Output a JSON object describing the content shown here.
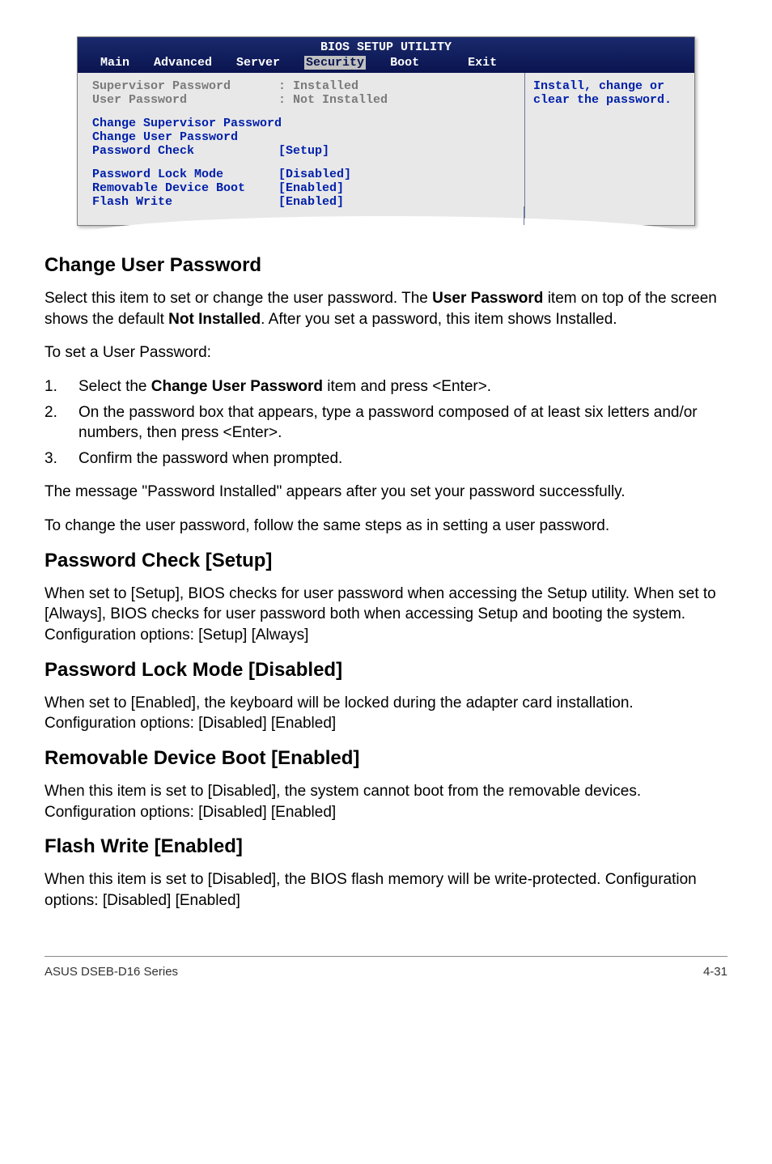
{
  "bios": {
    "title": "BIOS SETUP UTILITY",
    "tabs": {
      "main": "Main",
      "advanced": "Advanced",
      "server": "Server",
      "security": "Security",
      "boot": "Boot",
      "exit": "Exit"
    },
    "left": {
      "sup_pwd_label": "Supervisor Password",
      "sup_pwd_value": ": Installed",
      "user_pwd_label": "User Password",
      "user_pwd_value": ": Not Installed",
      "change_sup": "Change Supervisor Password",
      "change_user": "Change User Password",
      "pwd_check": "Password Check",
      "pwd_check_val": "[Setup]",
      "pwd_lock": "Password Lock Mode",
      "pwd_lock_val": "[Disabled]",
      "removable": "Removable Device Boot",
      "removable_val": "[Enabled]",
      "flash": "Flash Write",
      "flash_val": "[Enabled]"
    },
    "right": {
      "help1": "Install, change or",
      "help2": "clear the password."
    }
  },
  "sections": {
    "cup": {
      "heading": "Change User Password",
      "p1a": "Select this item to set or change the user password. The ",
      "p1b": "User Password",
      "p1c": " item on top of the screen shows the default ",
      "p1d": "Not Installed",
      "p1e": ". After you set a password, this item shows Installed.",
      "p2": "To set a User Password:",
      "li1a": "Select the ",
      "li1b": "Change User Password",
      "li1c": " item and press <Enter>.",
      "li2": "On the password box that appears, type a password composed of at least six letters and/or numbers, then press <Enter>.",
      "li3": "Confirm the password when prompted.",
      "p3": "The message \"Password Installed\" appears after you set your password successfully.",
      "p4": "To change the user password, follow the same steps as in setting a user password."
    },
    "pcs": {
      "heading": "Password Check [Setup]",
      "p": "When set to [Setup], BIOS checks for user password when accessing the Setup utility. When set to [Always], BIOS checks for user password both when accessing Setup and booting the system. Configuration options: [Setup] [Always]"
    },
    "plm": {
      "heading": "Password Lock Mode [Disabled]",
      "p": "When set to [Enabled], the keyboard will be locked during the adapter card installation. Configuration options: [Disabled] [Enabled]"
    },
    "rdb": {
      "heading": "Removable Device Boot [Enabled]",
      "p": "When this item is set to [Disabled], the system cannot boot from the removable devices. Configuration options: [Disabled] [Enabled]"
    },
    "fw": {
      "heading": "Flash Write [Enabled]",
      "p": "When this item is set to [Disabled], the BIOS flash memory will be write-protected. Configuration options: [Disabled] [Enabled]"
    }
  },
  "footer": {
    "left": "ASUS DSEB-D16 Series",
    "right": "4-31"
  }
}
